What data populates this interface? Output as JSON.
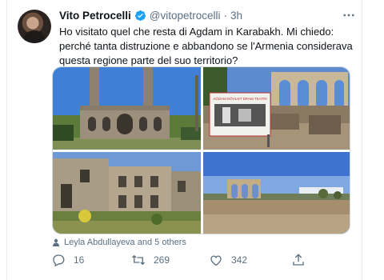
{
  "tweet": {
    "author_name": "Vito Petrocelli",
    "handle": "@vitopetrocelli",
    "separator": "·",
    "time": "3h",
    "text": "Ho visitato quel che resta di Agdam in Karabakh. Mi chiedo: perché tanta distruzione e abbandono se l'Armenia considerava questa regione parte del suo territorio?",
    "more_icon": "more-horizontal-icon",
    "verified_icon": "verified-badge-icon",
    "tagged_people": "Leyla Abdullayeva and 5 others",
    "photo_sign_text": "AĞDAM DÖVLƏT DRAM TEATRI",
    "metrics": {
      "replies": "16",
      "retweets": "269",
      "likes": "342"
    },
    "colors": {
      "accent": "#1da1f2",
      "secondary_text": "#5b7083"
    }
  }
}
